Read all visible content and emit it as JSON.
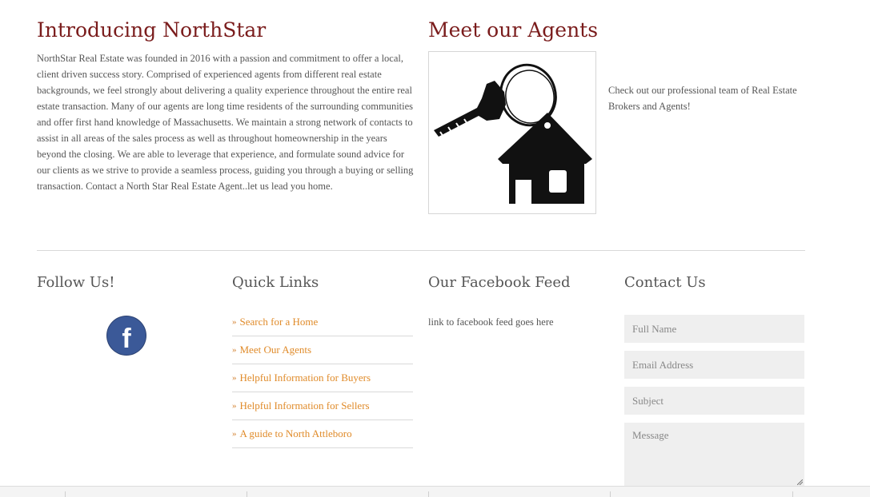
{
  "intro": {
    "heading": "Introducing NorthStar",
    "body": "NorthStar Real Estate was founded in 2016 with a passion and commitment to offer a local, client driven success story. Comprised of experienced agents from different real estate backgrounds, we feel strongly about delivering a quality experience throughout the entire real estate transaction. Many of our agents are long time residents of the surrounding communities and offer first hand knowledge of Massachusetts. We maintain a strong network of contacts to assist in all areas of the sales process as well as throughout homeownership in the years beyond the closing. We are able to leverage that experience, and formulate sound advice for our clients as we strive to provide a seamless process, guiding you through a buying or selling transaction. Contact a North Star Real Estate Agent..let us lead you home."
  },
  "agents": {
    "heading": "Meet our Agents",
    "image_icon": "house-key-icon",
    "text": "Check out our professional team of Real Estate Brokers and Agents!"
  },
  "footer": {
    "follow": {
      "heading": "Follow Us!",
      "facebook_icon": "facebook-icon",
      "facebook_glyph": "f"
    },
    "quick_links": {
      "heading": "Quick Links",
      "chevron": "»",
      "items": [
        {
          "label": "Search for a Home"
        },
        {
          "label": "Meet Our Agents"
        },
        {
          "label": "Helpful Information for Buyers"
        },
        {
          "label": "Helpful Information for Sellers"
        },
        {
          "label": "A guide to North Attleboro"
        }
      ]
    },
    "facebook_feed": {
      "heading": "Our Facebook Feed",
      "text": "link to facebook feed goes here"
    },
    "contact": {
      "heading": "Contact Us",
      "full_name_placeholder": "Full Name",
      "email_placeholder": "Email Address",
      "subject_placeholder": "Subject",
      "message_placeholder": "Message"
    }
  },
  "colors": {
    "heading_red": "#7a1c1c",
    "link_orange": "#e08b2a",
    "facebook_blue": "#3b5998",
    "field_bg": "#efefef"
  }
}
